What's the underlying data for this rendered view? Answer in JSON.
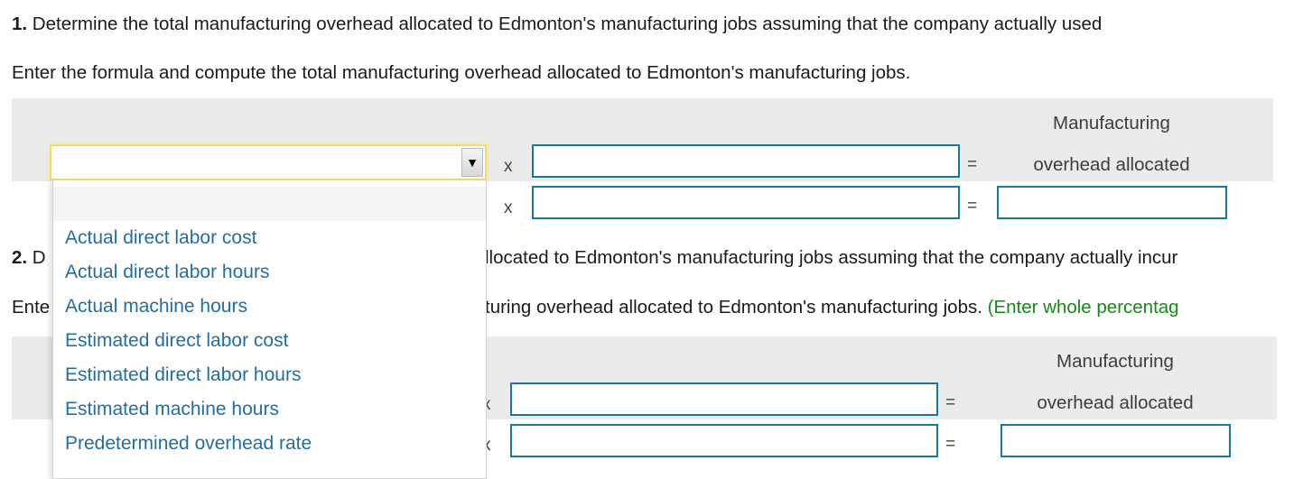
{
  "part1": {
    "number": "1.",
    "question": " Determine the total manufacturing overhead allocated to Edmonton's manufacturing jobs assuming that the company actually used",
    "instruction": "Enter the formula and compute the total manufacturing overhead allocated to Edmonton's manufacturing jobs.",
    "table": {
      "header_line1": "Manufacturing",
      "header_line2": "overhead allocated",
      "multiply_symbol": "x",
      "equals_symbol": "="
    }
  },
  "part2": {
    "number": "2.",
    "question_prefix": " D",
    "question_suffix": "llocated to Edmonton's manufacturing jobs assuming that the company actually incur",
    "instruction_prefix": "Ente",
    "instruction_suffix": "turing overhead allocated to Edmonton's manufacturing jobs. ",
    "hint": "(Enter whole percentag",
    "table": {
      "header_line1": "Manufacturing",
      "header_line2": "overhead allocated",
      "multiply_symbol": "x",
      "equals_symbol": "="
    }
  },
  "dropdown": {
    "selected": "",
    "arrow_icon": "▼",
    "options": [
      "Actual direct labor cost",
      "Actual direct labor hours",
      "Actual machine hours",
      "Estimated direct labor cost",
      "Estimated direct labor hours",
      "Estimated machine hours",
      "Predetermined overhead rate"
    ]
  },
  "colors": {
    "input_border": "#137a9b",
    "option_text": "#1f6ea8",
    "hint_text": "#148a14",
    "focus_ring": "#f6dc6a",
    "band": "#ebebeb"
  }
}
